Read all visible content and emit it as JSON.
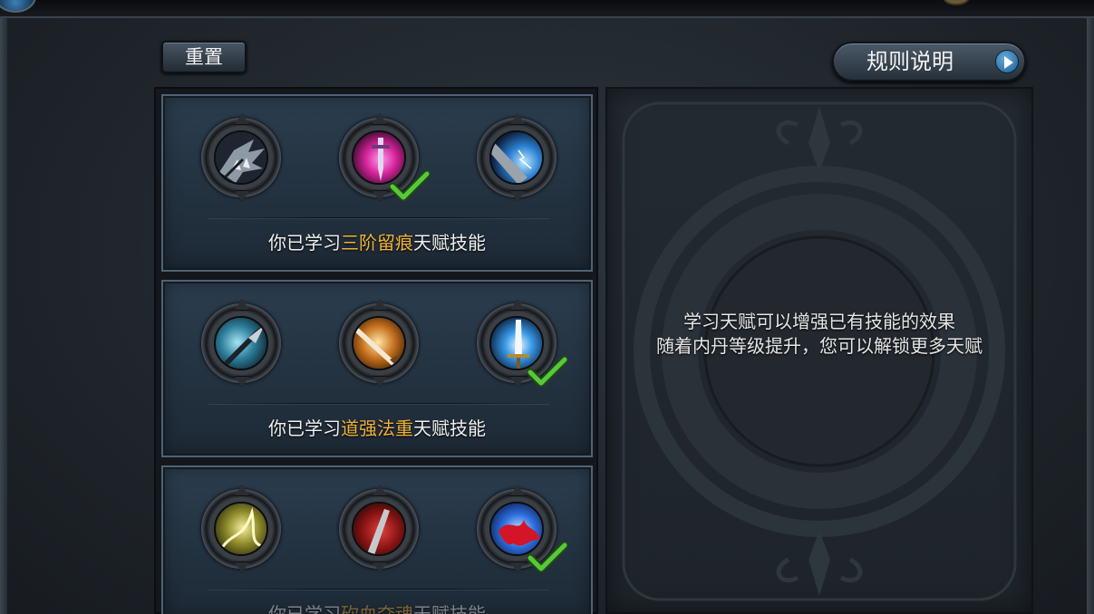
{
  "buttons": {
    "reset_label": "重置",
    "rules_label": "规则说明"
  },
  "talent_rows": [
    {
      "text_prefix": "你已学习",
      "highlight": "三阶留痕",
      "text_suffix": "天赋技能",
      "skills": [
        {
          "icon": "beast-claw-icon",
          "learned": false
        },
        {
          "icon": "magic-sword-icon",
          "learned": true
        },
        {
          "icon": "lightning-blade-icon",
          "learned": false
        }
      ]
    },
    {
      "text_prefix": "你已学习",
      "highlight": "道强法重",
      "text_suffix": "天赋技能",
      "skills": [
        {
          "icon": "spear-strike-icon",
          "learned": false
        },
        {
          "icon": "flaming-sword-icon",
          "learned": false
        },
        {
          "icon": "holy-sword-icon",
          "learned": true
        }
      ]
    },
    {
      "text_prefix": "你已学习",
      "highlight": "砍血夺魂",
      "text_suffix": "天赋技能",
      "skills": [
        {
          "icon": "golden-dragon-icon",
          "learned": false
        },
        {
          "icon": "blood-blade-icon",
          "learned": false
        },
        {
          "icon": "blood-splash-icon",
          "learned": true
        }
      ]
    }
  ],
  "info": {
    "line1": "学习天赋可以增强已有技能的效果",
    "line2": "随着内丹等级提升，您可以解锁更多天赋"
  },
  "colors": {
    "highlight": "#f0b23a",
    "check": "#58c83a",
    "panel_blue": "#2b3d4e"
  }
}
